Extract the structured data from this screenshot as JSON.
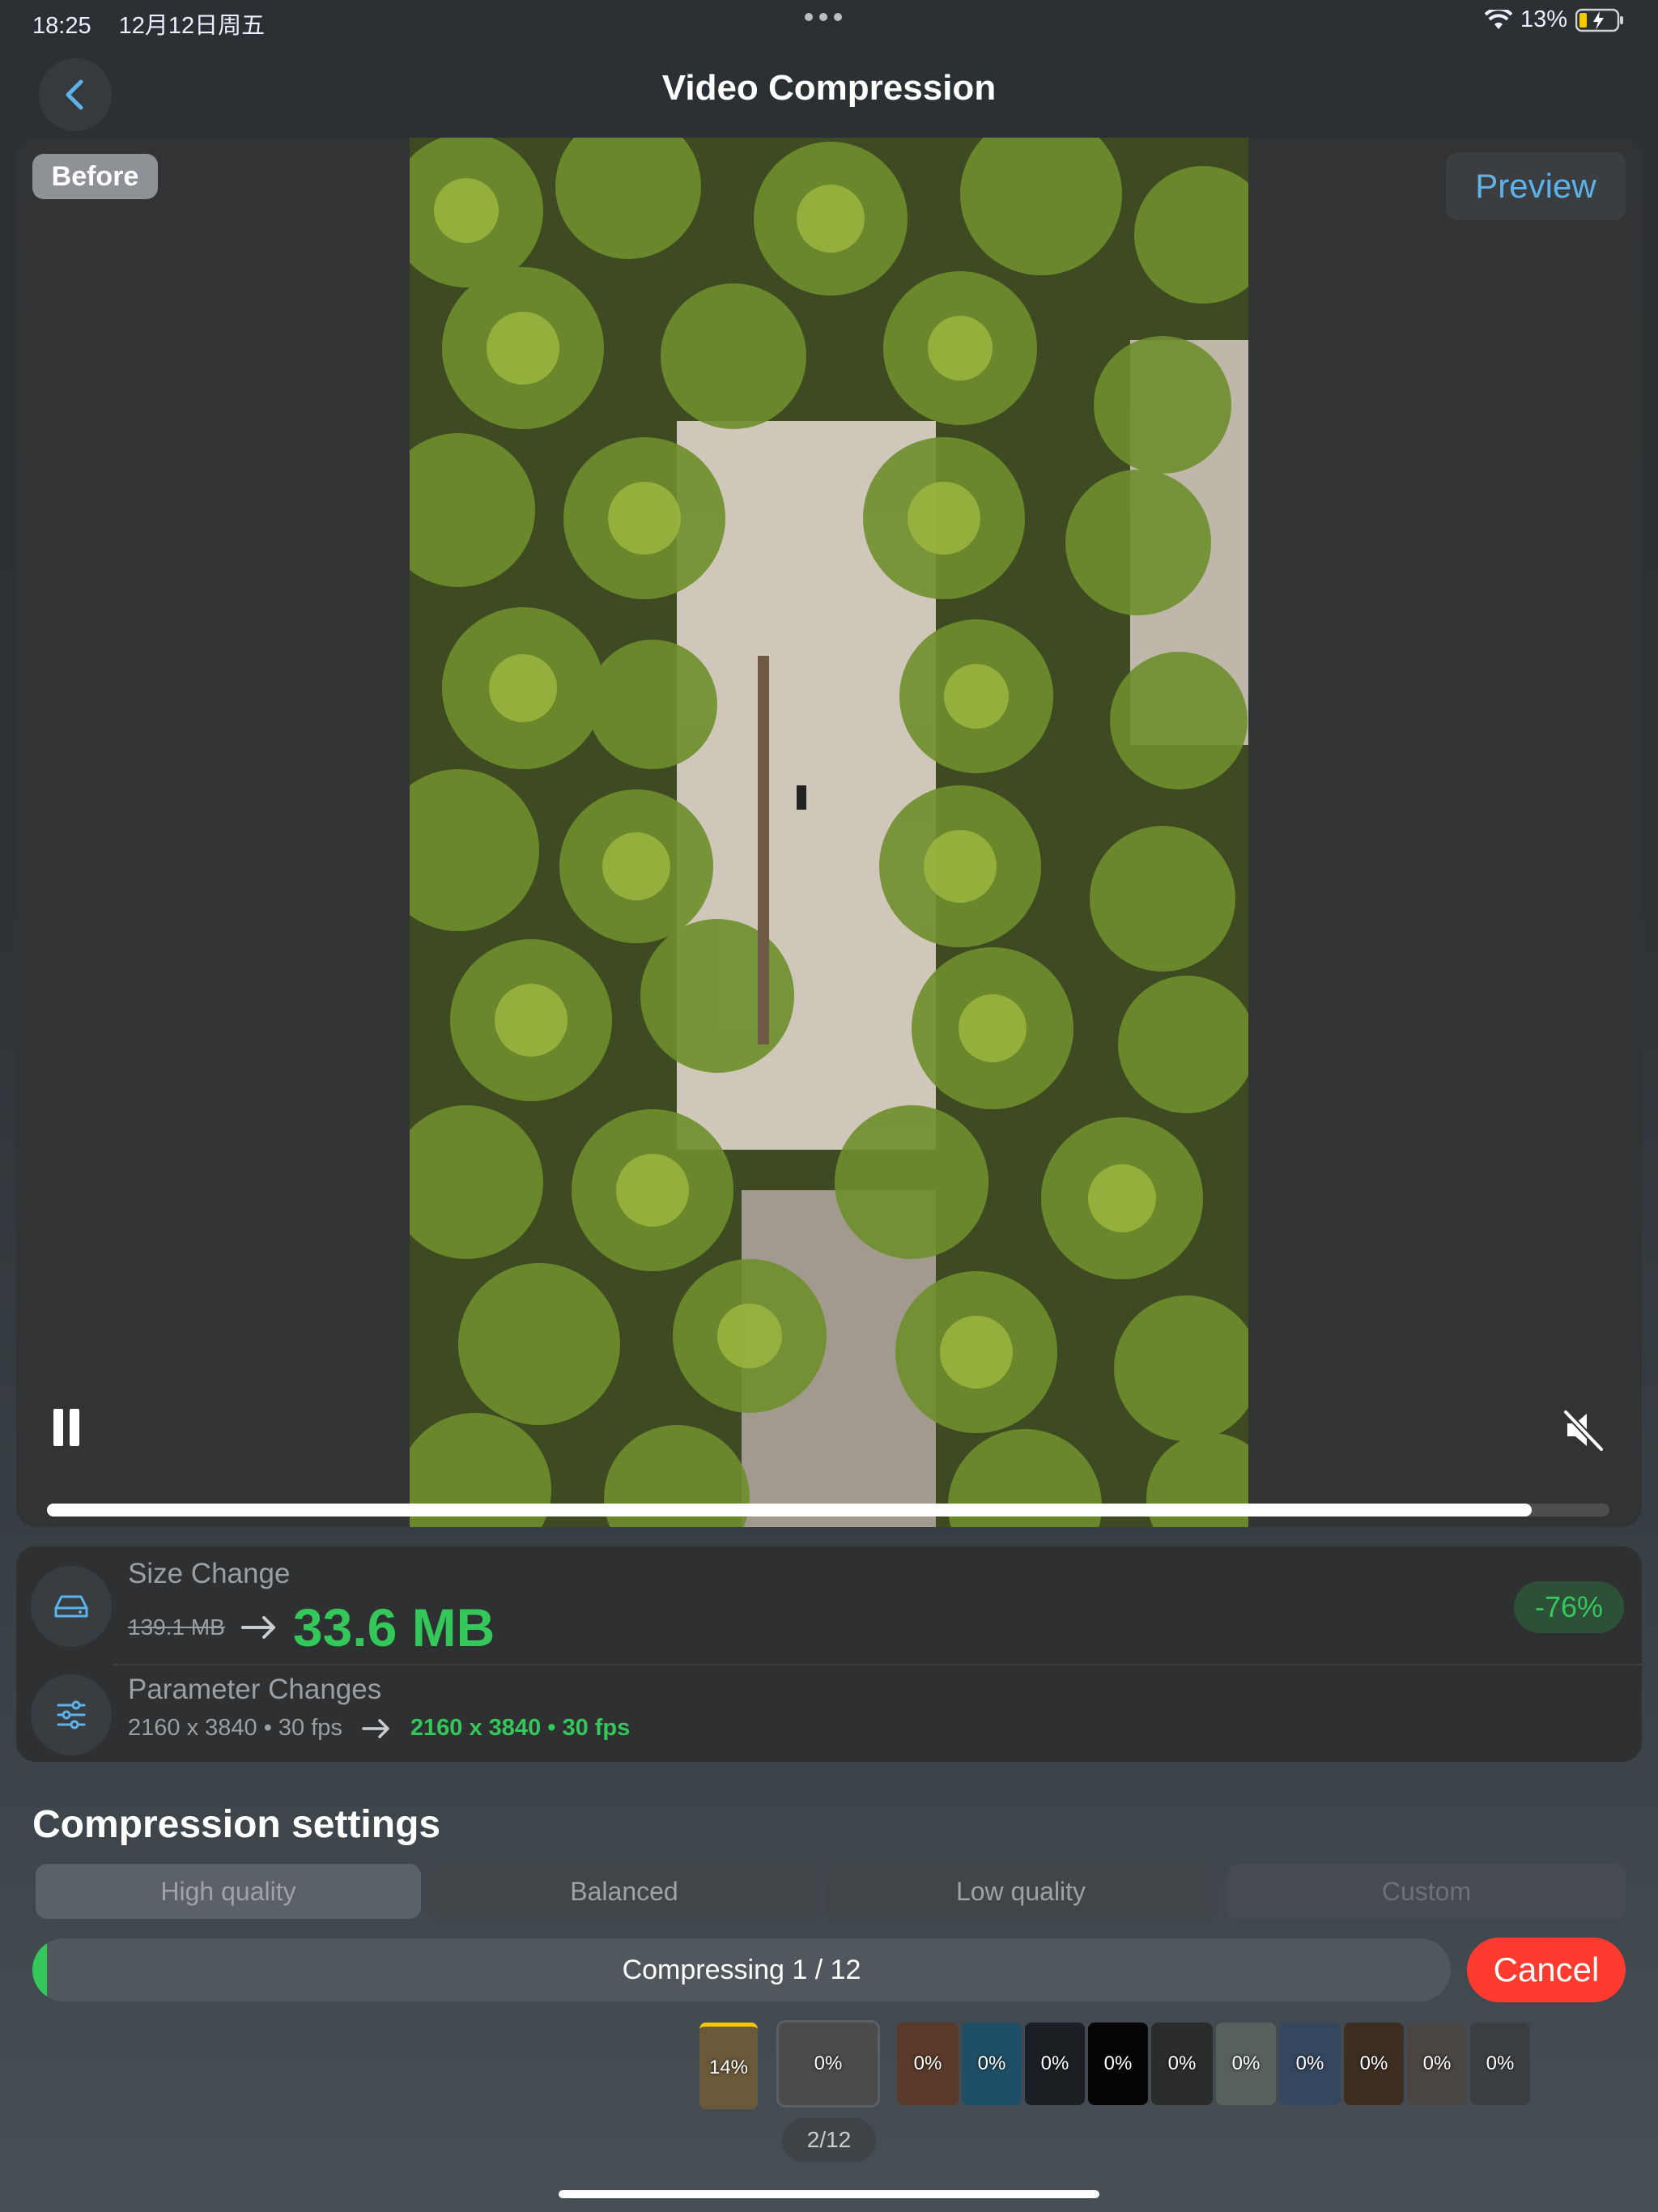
{
  "status_bar": {
    "time": "18:25",
    "date": "12月12日周五",
    "battery_percent": "13%",
    "icons": [
      "wifi-icon",
      "battery-charging-icon"
    ]
  },
  "nav": {
    "title": "Video Compression",
    "back_icon": "chevron-left-icon"
  },
  "player": {
    "before_label": "Before",
    "preview_label": "Preview",
    "progress_fraction": 0.95,
    "is_playing": true,
    "is_muted": true
  },
  "size_change": {
    "label": "Size Change",
    "old_size": "139.1 MB",
    "new_size": "33.6 MB",
    "percent": "-76%",
    "icon": "drive-icon"
  },
  "parameter_change": {
    "label": "Parameter Changes",
    "old_params": "2160 x 3840 • 30 fps",
    "new_params": "2160 x 3840 • 30 fps",
    "icon": "sliders-icon"
  },
  "compression": {
    "title": "Compression settings",
    "options": [
      "High quality",
      "Balanced",
      "Low quality",
      "Custom"
    ],
    "selected": "High quality",
    "status_text": "Compressing 1 / 12",
    "progress_fraction": 0.01,
    "cancel_label": "Cancel"
  },
  "queue": {
    "counter": "2/12",
    "items": [
      {
        "label": "14%",
        "color": "#6b5a3a"
      },
      {
        "label": "0%",
        "color": "#4a4b4a"
      },
      {
        "label": "0%",
        "color": "#5a3a2a"
      },
      {
        "label": "0%",
        "color": "#1e4f66"
      },
      {
        "label": "0%",
        "color": "#1c1f24"
      },
      {
        "label": "0%",
        "color": "#050505"
      },
      {
        "label": "0%",
        "color": "#2a2d2a"
      },
      {
        "label": "0%",
        "color": "#56605c"
      },
      {
        "label": "0%",
        "color": "#34475e"
      },
      {
        "label": "0%",
        "color": "#3d2e22"
      },
      {
        "label": "0%",
        "color": "#4a4442"
      },
      {
        "label": "0%",
        "color": "#3c3f42"
      }
    ]
  },
  "colors": {
    "accent_green": "#34c759",
    "accent_blue": "#5eb2ea",
    "cancel_red": "#ff3b30"
  }
}
